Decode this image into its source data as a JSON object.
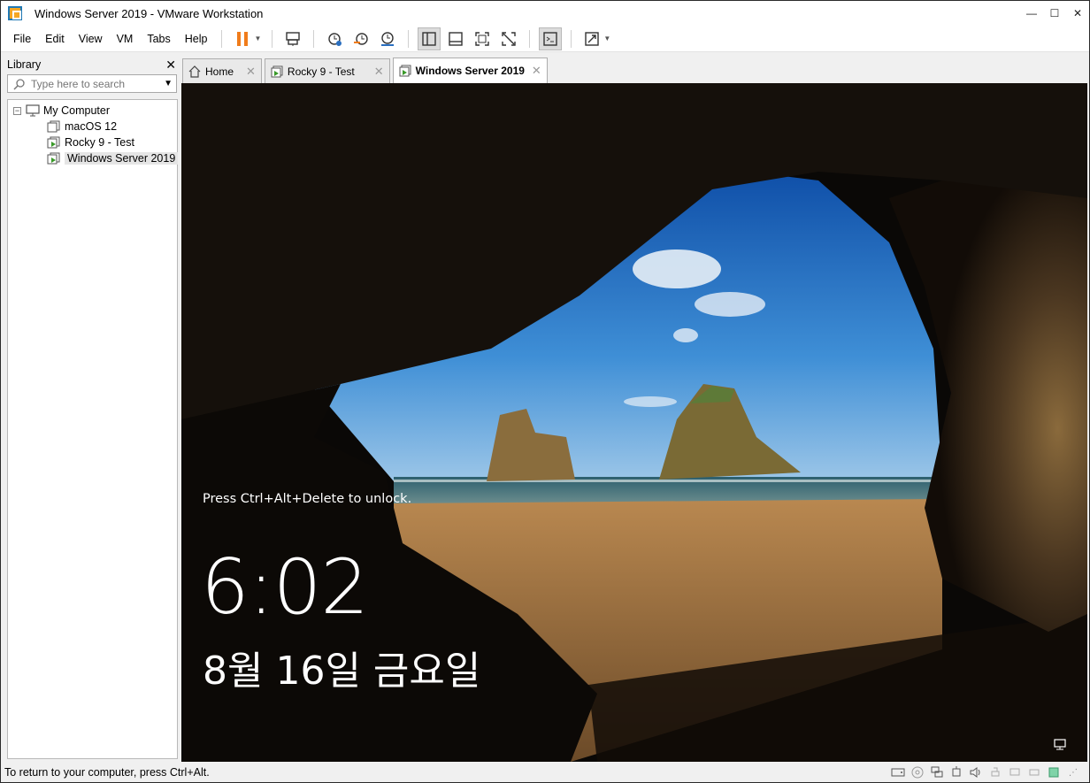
{
  "window": {
    "title": "Windows Server 2019 - VMware Workstation",
    "minimize": "—",
    "maximize": "☐",
    "close": "✕"
  },
  "menu": [
    "File",
    "Edit",
    "View",
    "VM",
    "Tabs",
    "Help"
  ],
  "library": {
    "title": "Library",
    "close": "✕",
    "search_placeholder": "Type here to search",
    "tree": {
      "root_label": "My Computer",
      "items": [
        {
          "label": "macOS 12",
          "running": false
        },
        {
          "label": "Rocky 9 - Test",
          "running": true
        },
        {
          "label": "Windows Server 2019",
          "running": true,
          "selected": true
        }
      ]
    }
  },
  "tabs": [
    {
      "label": "Home",
      "icon": "home-icon",
      "active": false
    },
    {
      "label": "Rocky 9 - Test",
      "icon": "vm-running-icon",
      "active": false
    },
    {
      "label": "Windows Server 2019",
      "icon": "vm-running-icon",
      "active": true
    }
  ],
  "lockscreen": {
    "message": "Press Ctrl+Alt+Delete to unlock.",
    "time": "6:02",
    "date": "8월 16일 금요일"
  },
  "status": {
    "text": "To return to your computer, press Ctrl+Alt."
  },
  "colors": {
    "accent_orange": "#f07c1b",
    "running_green": "#3a9a2a",
    "sky": "#2a6fc0"
  }
}
